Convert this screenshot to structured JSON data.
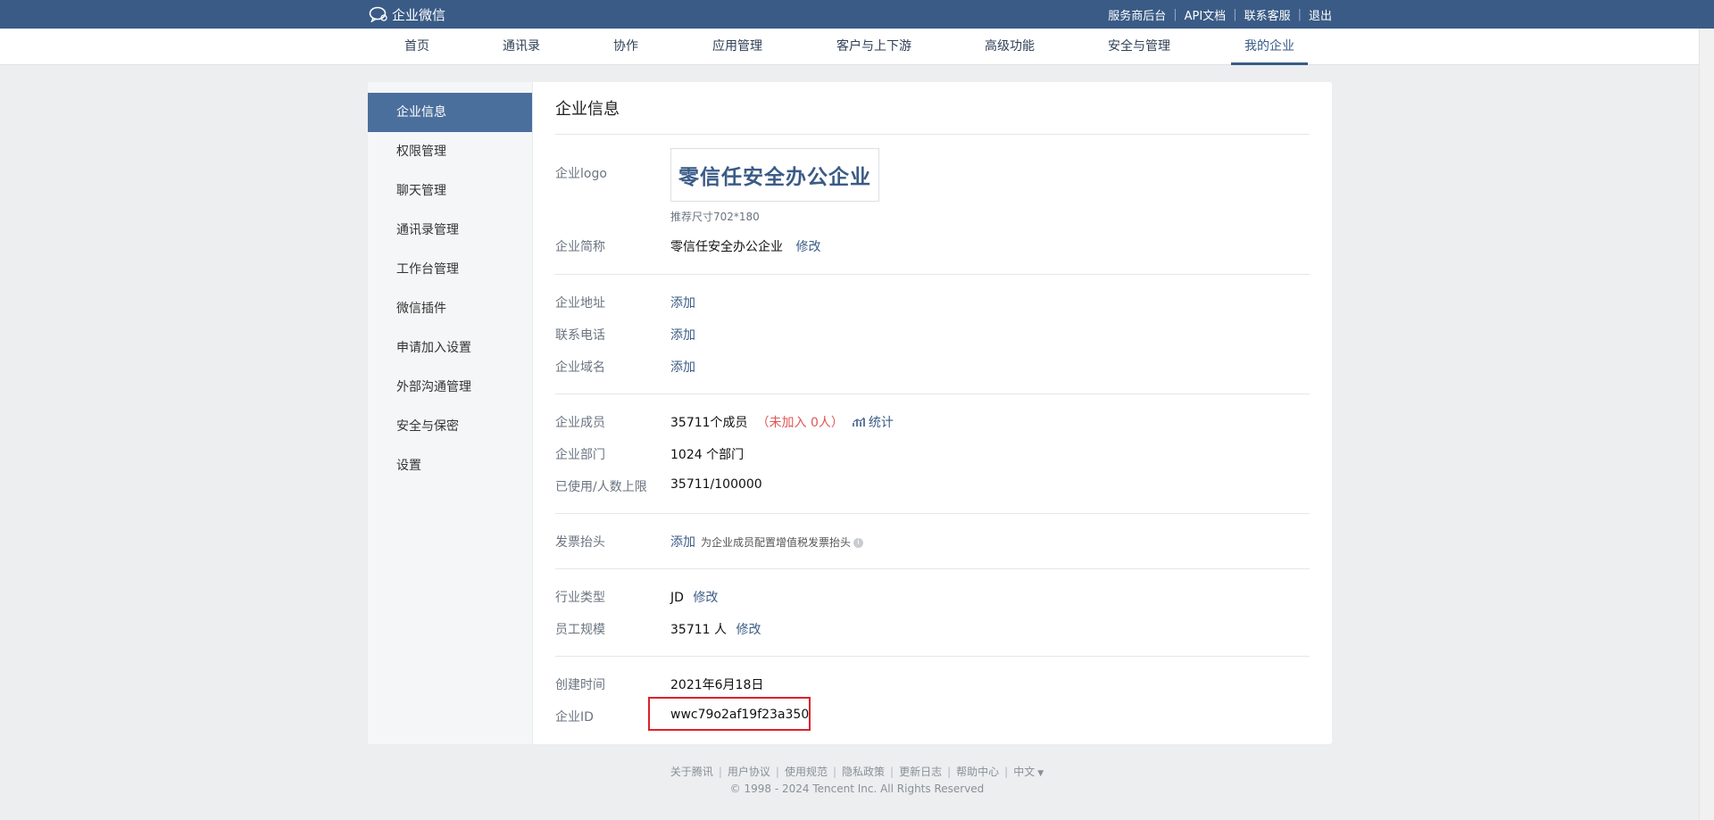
{
  "brand": {
    "name": "企业微信"
  },
  "toplinks": [
    "服务商后台",
    "API文档",
    "联系客服",
    "退出"
  ],
  "nav": [
    "首页",
    "通讯录",
    "协作",
    "应用管理",
    "客户与上下游",
    "高级功能",
    "安全与管理",
    "我的企业"
  ],
  "nav_active": "我的企业",
  "sidebar": [
    "企业信息",
    "权限管理",
    "聊天管理",
    "通讯录管理",
    "工作台管理",
    "微信插件",
    "申请加入设置",
    "外部沟通管理",
    "安全与保密",
    "设置"
  ],
  "sidebar_active": "企业信息",
  "page": {
    "title": "企业信息",
    "logo_label": "企业logo",
    "logo_text": "零信任安全办公企业",
    "logo_hint": "推荐尺寸702*180",
    "short_name_label": "企业简称",
    "short_name": "零信任安全办公企业",
    "edit": "修改",
    "address_label": "企业地址",
    "phone_label": "联系电话",
    "domain_label": "企业域名",
    "add": "添加",
    "members_label": "企业成员",
    "members_value": "35711个成员",
    "members_pending": "（未加入 0人）",
    "stats": "统计",
    "departments_label": "企业部门",
    "departments_value": "1024 个部门",
    "usage_label": "已使用/人数上限",
    "usage_value": "35711/100000",
    "invoice_label": "发票抬头",
    "invoice_hint": "为企业成员配置增值税发票抬头",
    "industry_label": "行业类型",
    "industry_value": "JD",
    "size_label": "员工规模",
    "size_value": "35711 人",
    "created_label": "创建时间",
    "created_value": "2021年6月18日",
    "corp_id_label": "企业ID",
    "corp_id_value": "wwc79o2af19f23a350"
  },
  "footer": {
    "links": [
      "关于腾讯",
      "用户协议",
      "使用规范",
      "隐私政策",
      "更新日志",
      "帮助中心"
    ],
    "language": "中文",
    "copyright": "© 1998 - 2024 Tencent Inc. All Rights Reserved"
  },
  "colors": {
    "accent": "#3a5b86",
    "sidebar_active": "#4a6f9c",
    "highlight_box": "#e0202a",
    "warning_text": "#e05555"
  }
}
